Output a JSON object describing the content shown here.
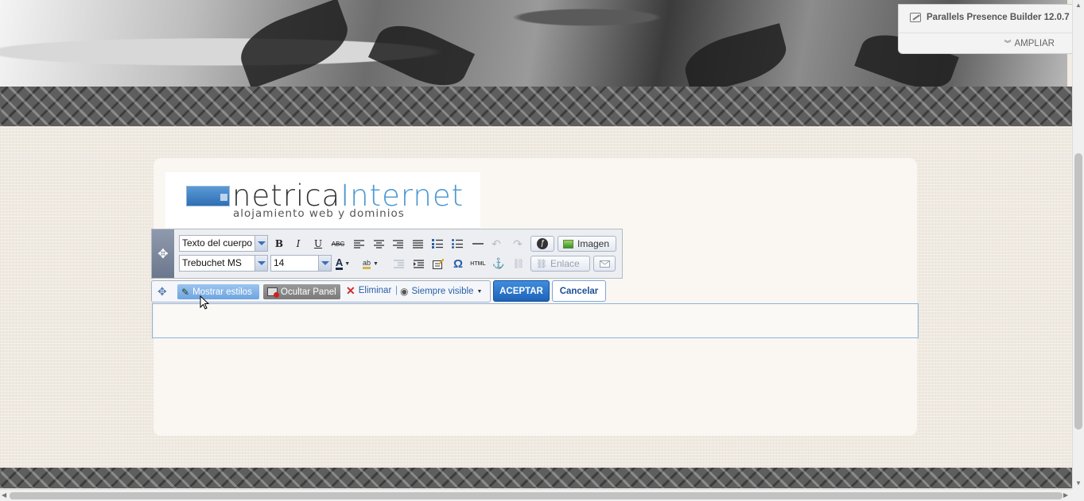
{
  "presence_panel": {
    "title": "Parallels Presence Builder 12.0.7",
    "expand_label": "AMPLIAR"
  },
  "logo": {
    "name_part1": "netrica",
    "name_part2": "Internet",
    "tagline": "alojamiento web y dominios"
  },
  "editor": {
    "style_select": "Texto del cuerpo",
    "font_select": "Trebuchet MS",
    "size_select": "14",
    "image_button": "Imagen",
    "link_button": "Enlace",
    "html_label": "HTML",
    "icons": [
      "bold-icon",
      "italic-icon",
      "underline-icon",
      "strikethrough-icon",
      "align-left-icon",
      "align-center-icon",
      "align-right-icon",
      "justify-icon",
      "numbered-list-icon",
      "bulleted-list-icon",
      "horizontal-rule-icon",
      "undo-icon",
      "redo-icon",
      "flash-icon",
      "image-icon",
      "font-color-icon",
      "highlight-color-icon",
      "outdent-icon",
      "indent-icon",
      "edit-table-icon",
      "omega-icon",
      "html-icon",
      "anchor-icon",
      "unlink-icon",
      "link-icon",
      "email-icon"
    ]
  },
  "actionbar": {
    "show_styles": "Mostrar estilos",
    "hide_panel": "Ocultar Panel",
    "delete": "Eliminar",
    "separator": "|",
    "visibility": "Siempre visible",
    "accept": "ACEPTAR",
    "cancel": "Cancelar"
  },
  "glyphs": {
    "bold": "B",
    "italic": "I",
    "underline": "U",
    "strike": "ABC",
    "omega": "Ω",
    "anchor": "⚓"
  },
  "colors": {
    "accent": "#2b5fa8",
    "accept_button": "#2a74cc",
    "logo_blue": "#4a97d1",
    "delete_red": "#d42a2a",
    "show_styles_chip": "#7fb0e6",
    "hide_panel_chip": "#8b8b8b"
  }
}
